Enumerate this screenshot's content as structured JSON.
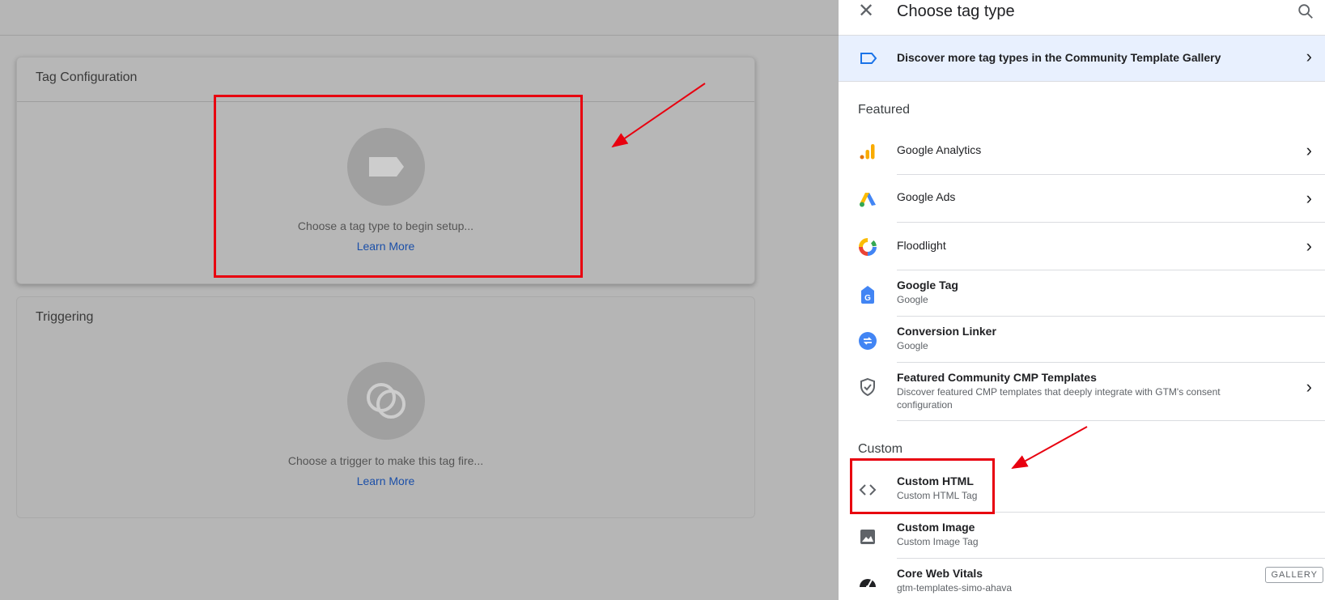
{
  "background": {
    "tag_card": {
      "title": "Tag Configuration",
      "hint": "Choose a tag type to begin setup...",
      "link": "Learn More"
    },
    "trigger_card": {
      "title": "Triggering",
      "hint": "Choose a trigger to make this tag fire...",
      "link": "Learn More"
    }
  },
  "panel": {
    "title": "Choose tag type",
    "close_icon": "close-icon",
    "search_icon": "search-icon",
    "banner": {
      "text": "Discover more tag types in the Community Template Gallery",
      "icon": "tag-outline-icon"
    },
    "featured_label": "Featured",
    "featured": [
      {
        "title": "Google Analytics",
        "subtitle": "",
        "icon": "analytics-icon"
      },
      {
        "title": "Google Ads",
        "subtitle": "",
        "icon": "google-ads-icon"
      },
      {
        "title": "Floodlight",
        "subtitle": "",
        "icon": "floodlight-icon"
      },
      {
        "title": "Google Tag",
        "subtitle": "Google",
        "icon": "google-tag-icon"
      },
      {
        "title": "Conversion Linker",
        "subtitle": "Google",
        "icon": "conversion-linker-icon"
      },
      {
        "title": "Featured Community CMP Templates",
        "subtitle": "Discover featured CMP templates that deeply integrate with GTM's consent configuration",
        "icon": "shield-check-icon"
      }
    ],
    "custom_label": "Custom",
    "custom": [
      {
        "title": "Custom HTML",
        "subtitle": "Custom HTML Tag",
        "icon": "code-icon"
      },
      {
        "title": "Custom Image",
        "subtitle": "Custom Image Tag",
        "icon": "image-icon"
      },
      {
        "title": "Core Web Vitals",
        "subtitle": "gtm-templates-simo-ahava",
        "icon": "speedometer-icon",
        "badge": "GALLERY"
      }
    ]
  },
  "colors": {
    "accent": "#1a73e8",
    "annotation_red": "#e8000f",
    "banner_bg": "#e8f0fe"
  }
}
